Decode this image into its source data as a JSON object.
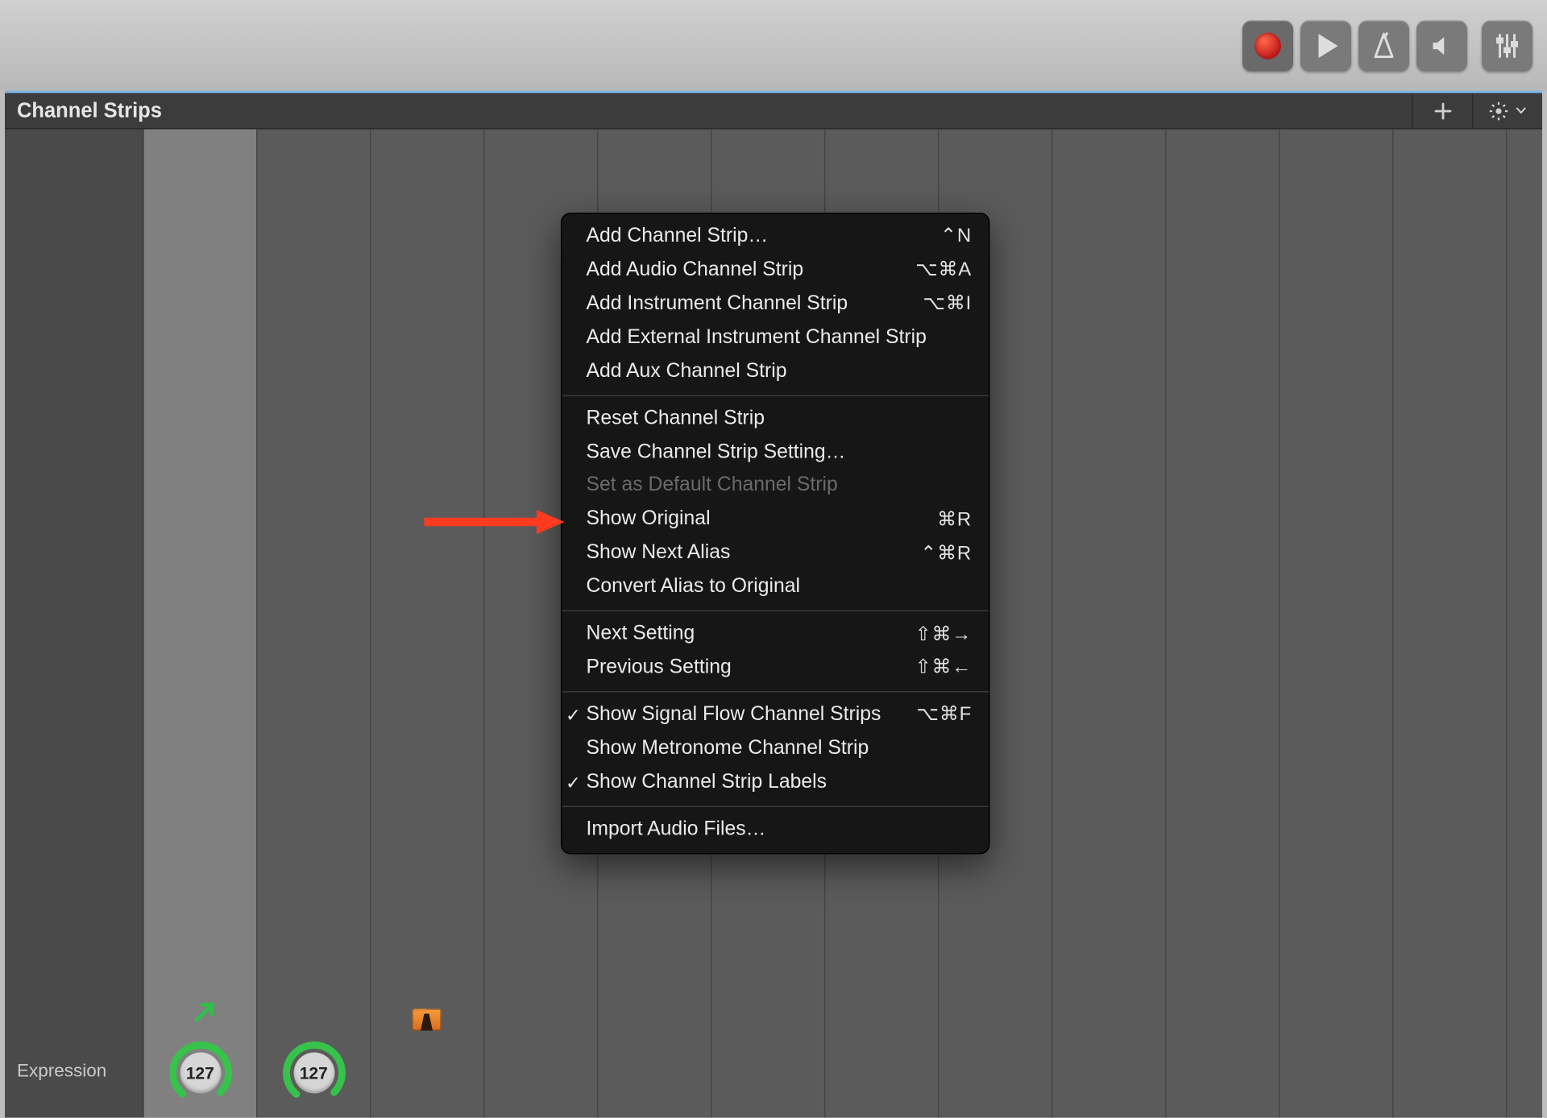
{
  "toolbar": {
    "record": "Record",
    "play": "Play",
    "metronome": "Metronome",
    "speaker": "Count-in",
    "mixer": "Mixer"
  },
  "panel": {
    "title": "Channel Strips",
    "label_row": "Expression",
    "knob_value_1": "127",
    "knob_value_2": "127"
  },
  "menu": {
    "groups": [
      [
        {
          "label": "Add Channel Strip…",
          "shortcut": "⌃N",
          "name": "add-channel-strip"
        },
        {
          "label": "Add Audio Channel Strip",
          "shortcut": "⌥⌘A",
          "name": "add-audio-channel-strip"
        },
        {
          "label": "Add Instrument Channel Strip",
          "shortcut": "⌥⌘I",
          "name": "add-instrument-channel-strip"
        },
        {
          "label": "Add External Instrument Channel Strip",
          "shortcut": "",
          "name": "add-external-instrument-channel-strip"
        },
        {
          "label": "Add Aux Channel Strip",
          "shortcut": "",
          "name": "add-aux-channel-strip"
        }
      ],
      [
        {
          "label": "Reset Channel Strip",
          "shortcut": "",
          "name": "reset-channel-strip"
        },
        {
          "label": "Save Channel Strip Setting…",
          "shortcut": "",
          "name": "save-channel-strip-setting"
        },
        {
          "label": "Set as Default Channel Strip",
          "shortcut": "",
          "name": "set-default-channel-strip",
          "disabled": true
        },
        {
          "label": "Show Original",
          "shortcut": "⌘R",
          "name": "show-original"
        },
        {
          "label": "Show Next Alias",
          "shortcut": "⌃⌘R",
          "name": "show-next-alias"
        },
        {
          "label": "Convert Alias to Original",
          "shortcut": "",
          "name": "convert-alias-to-original"
        }
      ],
      [
        {
          "label": "Next Setting",
          "shortcut": "⇧⌘→",
          "name": "next-setting"
        },
        {
          "label": "Previous Setting",
          "shortcut": "⇧⌘←",
          "name": "previous-setting"
        }
      ],
      [
        {
          "label": "Show Signal Flow Channel Strips",
          "shortcut": "⌥⌘F",
          "name": "show-signal-flow",
          "checked": true
        },
        {
          "label": "Show Metronome Channel Strip",
          "shortcut": "",
          "name": "show-metronome-strip"
        },
        {
          "label": "Show Channel Strip Labels",
          "shortcut": "",
          "name": "show-channel-strip-labels",
          "checked": true
        }
      ],
      [
        {
          "label": "Import Audio Files…",
          "shortcut": "",
          "name": "import-audio-files"
        }
      ]
    ]
  }
}
